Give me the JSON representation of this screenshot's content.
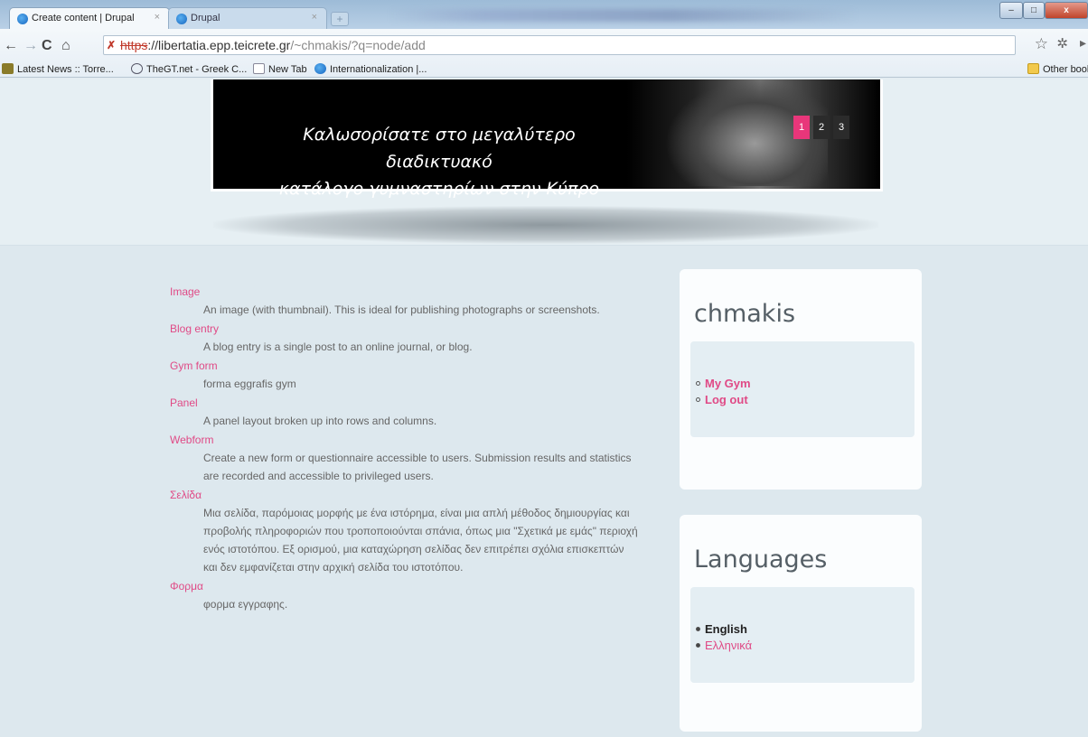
{
  "browser": {
    "tabs": [
      {
        "label": "Create content | Drupal",
        "close": "×"
      },
      {
        "label": "Drupal",
        "close": "×"
      }
    ],
    "new_tab": "+",
    "url": {
      "scheme": "https",
      "host": "://libertatia.epp.teicrete.gr",
      "path": "/~chmakis/?q=node/add"
    },
    "bookmarks": [
      "Latest News :: Torre...",
      "TheGT.net - Greek C...",
      "New Tab",
      "Internationalization |...",
      "Other bookmarks"
    ]
  },
  "banner": {
    "line1": "Καλωσορίσατε στο μεγαλύτερο διαδικτυακό",
    "line2": "κατάλογο γυμναστηρίων στην Κύπρο",
    "pager": [
      "1",
      "2",
      "3"
    ]
  },
  "content_types": [
    {
      "title": "Image",
      "desc": "An image (with thumbnail). This is ideal for publishing photographs or screenshots."
    },
    {
      "title": "Blog entry",
      "desc": "A blog entry is a single post to an online journal, or blog."
    },
    {
      "title": "Gym form",
      "desc": "forma eggrafis gym"
    },
    {
      "title": "Panel",
      "desc": "A panel layout broken up into rows and columns."
    },
    {
      "title": "Webform",
      "desc": "Create a new form or questionnaire accessible to users. Submission results and statistics are recorded and accessible to privileged users."
    },
    {
      "title": "Σελίδα",
      "desc": "Μια σελίδα, παρόμοιας μορφής με ένα ιστόρημα, είναι μια απλή μέθοδος δημιουργίας και προβολής πληροφοριών που τροποποιούνται σπάνια, όπως μια \"Σχετικά με εμάς\" περιοχή ενός ιστοτόπου. Εξ ορισμού, μια καταχώρηση σελίδας δεν επιτρέπει σχόλια επισκεπτών και δεν εμφανίζεται στην αρχική σελίδα του ιστοτόπου."
    },
    {
      "title": "Φορμα",
      "desc": "φορμα εγγραφης."
    }
  ],
  "user_block": {
    "title": "chmakis",
    "links": [
      "My Gym",
      "Log out"
    ]
  },
  "languages_block": {
    "title": "Languages",
    "current": "English",
    "other": "Ελληνικά"
  },
  "colors": {
    "link": "#e04a86",
    "pager_active": "#e8367a",
    "page_bg": "#dde8ee"
  }
}
